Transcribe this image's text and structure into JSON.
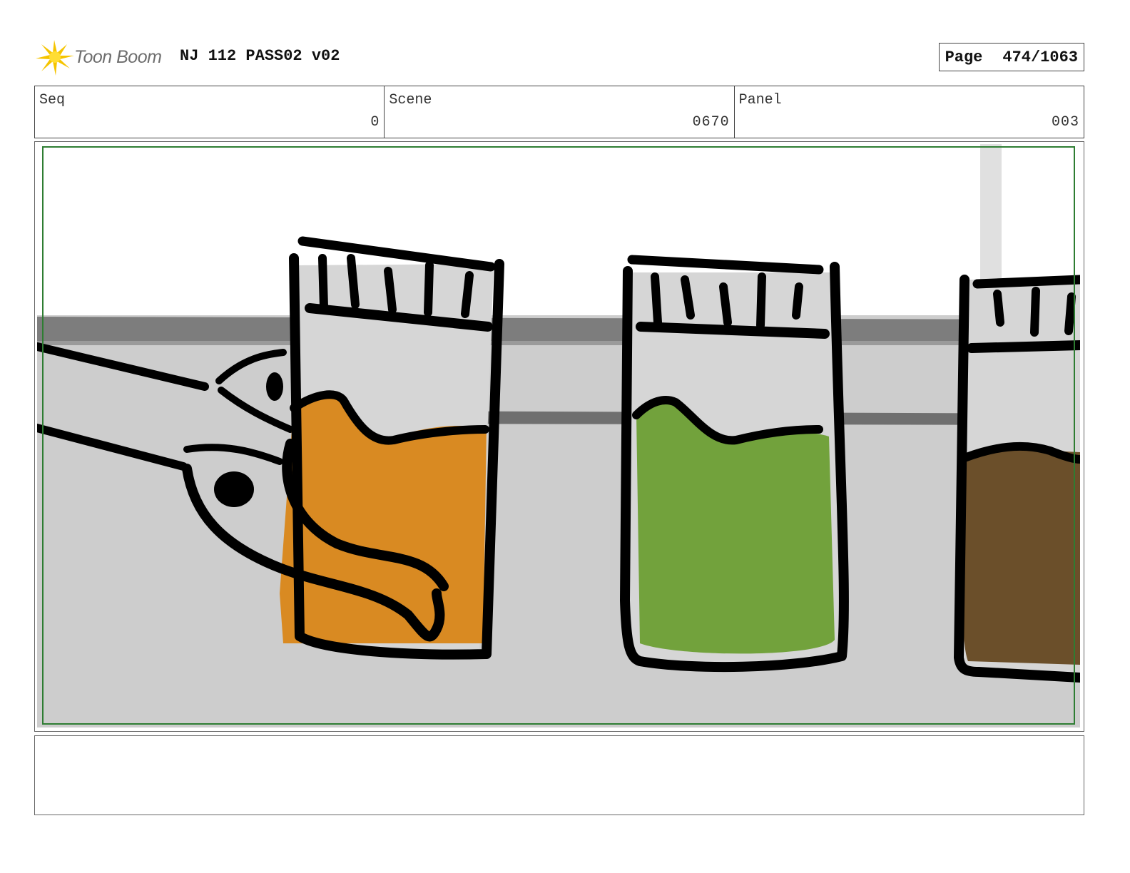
{
  "header": {
    "logo_text": "Toon Boom",
    "title": "NJ 112 PASS02 v02",
    "page_label": "Page",
    "page_value": "474/1063"
  },
  "info": {
    "seq_label": "Seq",
    "seq_value": "0",
    "scene_label": "Scene",
    "scene_value": "0670",
    "panel_label": "Panel",
    "panel_value": "003"
  },
  "panel": {
    "description": "",
    "colors": {
      "orange_liquid": "#d98a22",
      "green_liquid": "#72a23c",
      "brown_liquid": "#6b4f2a",
      "background_gray": "#cdcdcd",
      "shelf_gray": "#7a7a7a",
      "safe_frame": "#2e7d32"
    }
  },
  "notes": {
    "text": ""
  }
}
